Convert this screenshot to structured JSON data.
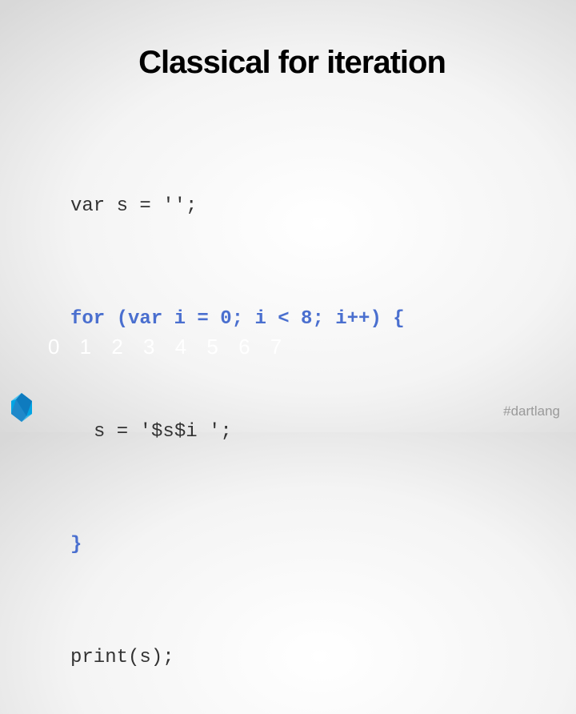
{
  "slide": {
    "title": "Classical for iteration",
    "code": [
      {
        "text": "var s = '';",
        "highlight": false,
        "indent": false
      },
      {
        "text": "for (var i = 0; i < 8; i++) {",
        "highlight": true,
        "indent": false
      },
      {
        "text": "s = '$s$i ';",
        "highlight": false,
        "indent": true
      },
      {
        "text": "}",
        "highlight": true,
        "indent": false
      },
      {
        "text": "print(s);",
        "highlight": false,
        "indent": false
      }
    ],
    "output": "0 1 2 3 4 5 6 7",
    "hashtag": "#dartlang"
  },
  "logo": {
    "icon": "dart-logo-icon"
  },
  "colors": {
    "keyword": "#4a6fcf",
    "code": "#333333",
    "title": "#000000",
    "output": "#ffffff",
    "hashtag": "#9a9a9a"
  }
}
